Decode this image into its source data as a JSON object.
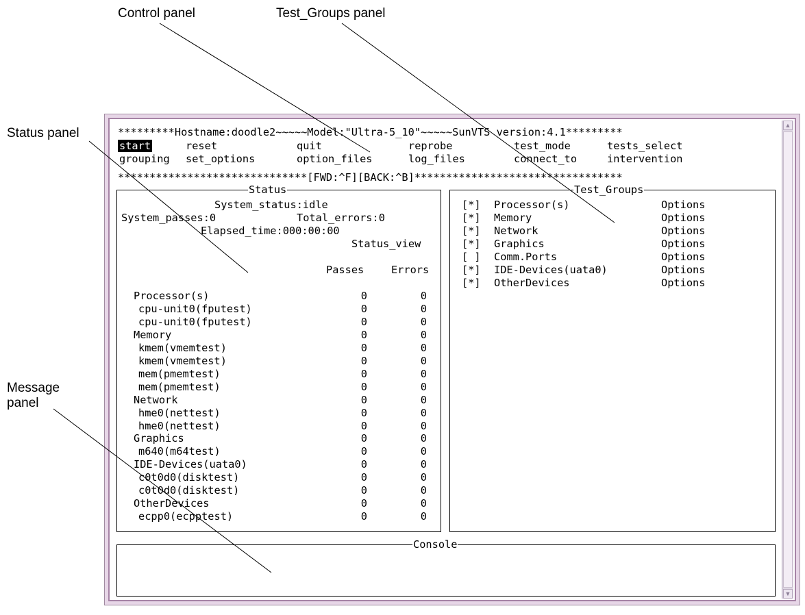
{
  "callouts": {
    "control_panel": "Control panel",
    "test_groups_panel": "Test_Groups panel",
    "status_panel": "Status panel",
    "message_panel": "Message\npanel"
  },
  "header": {
    "banner": "*********Hostname:doodle2~~~~~Model:\"Ultra-5_10\"~~~~~SunVTS version:4.1*********",
    "nav_line": "******************************[FWD:^F][BACK:^B]*********************************"
  },
  "menu": {
    "row1": [
      "start",
      "reset",
      "quit",
      "reprobe",
      "test_mode",
      "tests_select"
    ],
    "row2": [
      "grouping",
      "set_options",
      "option_files",
      "log_files",
      "connect_to",
      "intervention"
    ],
    "selected": "start"
  },
  "status": {
    "title": "Status",
    "system_status": "System_status:idle",
    "system_passes": "System_passes:0",
    "total_errors": "Total_errors:0",
    "elapsed_time": "Elapsed_time:000:00:00",
    "status_view": "Status_view",
    "col_passes": "Passes",
    "col_errors": "Errors",
    "rows": [
      {
        "label": "Processor(s)",
        "passes": "0",
        "errors": "0",
        "indent": 0
      },
      {
        "label": "cpu-unit0(fputest)",
        "passes": "0",
        "errors": "0",
        "indent": 1
      },
      {
        "label": "cpu-unit0(fputest)",
        "passes": "0",
        "errors": "0",
        "indent": 1
      },
      {
        "label": "Memory",
        "passes": "0",
        "errors": "0",
        "indent": 0
      },
      {
        "label": "kmem(vmemtest)",
        "passes": "0",
        "errors": "0",
        "indent": 1
      },
      {
        "label": "kmem(vmemtest)",
        "passes": "0",
        "errors": "0",
        "indent": 1
      },
      {
        "label": "mem(pmemtest)",
        "passes": "0",
        "errors": "0",
        "indent": 1
      },
      {
        "label": "mem(pmemtest)",
        "passes": "0",
        "errors": "0",
        "indent": 1
      },
      {
        "label": "Network",
        "passes": "0",
        "errors": "0",
        "indent": 0
      },
      {
        "label": "hme0(nettest)",
        "passes": "0",
        "errors": "0",
        "indent": 1
      },
      {
        "label": "hme0(nettest)",
        "passes": "0",
        "errors": "0",
        "indent": 1
      },
      {
        "label": "Graphics",
        "passes": "0",
        "errors": "0",
        "indent": 0
      },
      {
        "label": "m640(m64test)",
        "passes": "0",
        "errors": "0",
        "indent": 1
      },
      {
        "label": "IDE-Devices(uata0)",
        "passes": "0",
        "errors": "0",
        "indent": 0
      },
      {
        "label": "c0t0d0(disktest)",
        "passes": "0",
        "errors": "0",
        "indent": 1
      },
      {
        "label": "c0t0d0(disktest)",
        "passes": "0",
        "errors": "0",
        "indent": 1
      },
      {
        "label": "OtherDevices",
        "passes": "0",
        "errors": "0",
        "indent": 0
      },
      {
        "label": "ecpp0(ecpptest)",
        "passes": "0",
        "errors": "0",
        "indent": 1
      }
    ]
  },
  "test_groups": {
    "title": "Test_Groups",
    "items": [
      {
        "mark": "[*]",
        "name": "Processor(s)",
        "options": "Options"
      },
      {
        "mark": "[*]",
        "name": "Memory",
        "options": "Options"
      },
      {
        "mark": "[*]",
        "name": "Network",
        "options": "Options"
      },
      {
        "mark": "[*]",
        "name": "Graphics",
        "options": "Options"
      },
      {
        "mark": "[ ]",
        "name": "Comm.Ports",
        "options": "Options"
      },
      {
        "mark": "[*]",
        "name": "IDE-Devices(uata0)",
        "options": "Options"
      },
      {
        "mark": "[*]",
        "name": "OtherDevices",
        "options": "Options"
      }
    ]
  },
  "console": {
    "title": "Console"
  },
  "colors": {
    "window_frame": "#e7d6e7",
    "frame_border": "#a683a6",
    "selected_bg": "#000000",
    "selected_fg": "#ffffff"
  }
}
